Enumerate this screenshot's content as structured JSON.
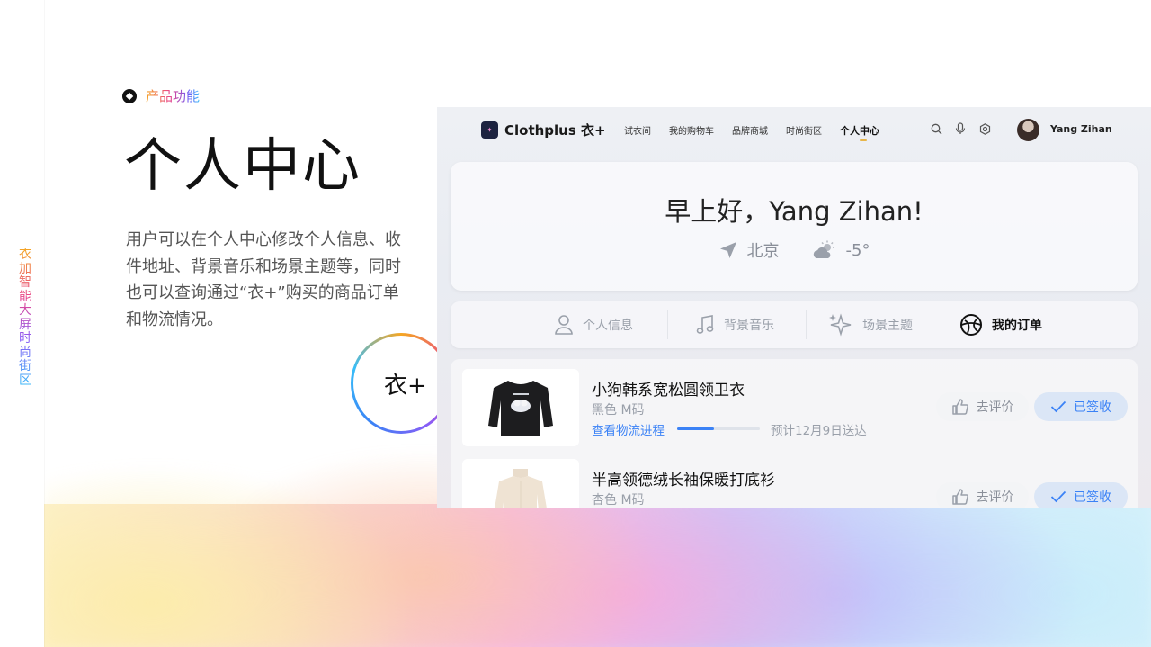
{
  "side": {
    "text": "衣加智能大屏时尚街区"
  },
  "slide": {
    "kicker": "产品功能",
    "title": "个人中心",
    "description": "用户可以在个人中心修改个人信息、收件地址、背景音乐和场景主题等，同时也可以查询通过“衣+”购买的商品订单和物流情况。",
    "brand_badge": "衣+"
  },
  "app": {
    "logo_icon": "clothplus-logo-icon",
    "name": "Clothplus 衣+",
    "nav": [
      "试衣间",
      "我的购物车",
      "品牌商城",
      "时尚街区",
      "个人中心"
    ],
    "nav_active_index": 4,
    "icons": [
      "search-icon",
      "microphone-icon",
      "settings-icon"
    ],
    "user": {
      "name": "Yang Zihan"
    },
    "greeting": {
      "title": "早上好，Yang Zihan!",
      "location": "北京",
      "temperature": "-5°"
    },
    "tabs": [
      {
        "label": "个人信息",
        "icon": "user-icon"
      },
      {
        "label": "背景音乐",
        "icon": "music-icon"
      },
      {
        "label": "场景主题",
        "icon": "sparkle-icon"
      },
      {
        "label": "我的订单",
        "icon": "orders-icon"
      }
    ],
    "active_tab_index": 3,
    "orders": [
      {
        "name": "小狗韩系宽松圆领卫衣",
        "variant": "黑色 M码",
        "track_label": "查看物流进程",
        "progress": 0.45,
        "eta": "预计12月9日送达",
        "review_label": "去评价",
        "signed_label": "已签收",
        "image_icon": "black-sweatshirt"
      },
      {
        "name": "半高领德绒长袖保暖打底衫",
        "variant": "杏色 M码",
        "review_label": "去评价",
        "signed_label": "已签收",
        "image_icon": "beige-turtleneck"
      }
    ]
  },
  "colors": {
    "accent_blue": "#3b82f6",
    "text_dark": "#111111",
    "muted": "#9aa0aa",
    "gradient": [
      "#f5a623",
      "#e8458b",
      "#8b5cf6",
      "#38bdf8"
    ]
  }
}
